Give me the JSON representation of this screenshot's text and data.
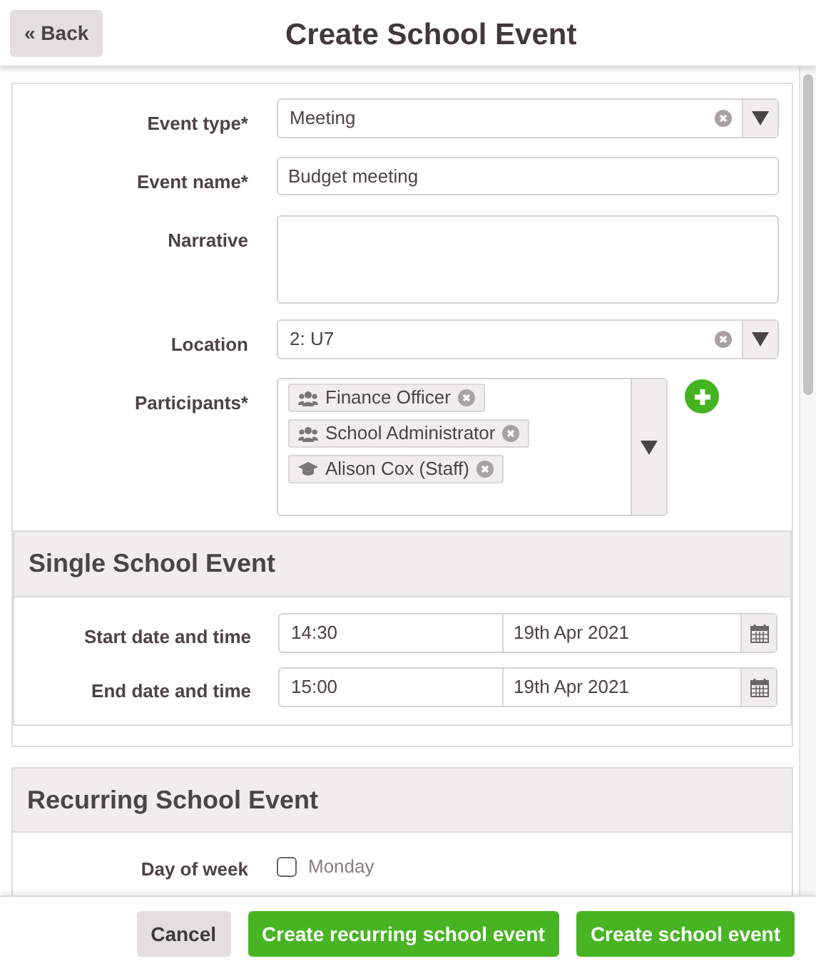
{
  "header": {
    "back_button": "« Back",
    "title": "Create School Event"
  },
  "fields": [
    {
      "kind": "select",
      "label": "Event type*",
      "value": "Meeting"
    },
    {
      "kind": "text",
      "label": "Event name*",
      "value": "Budget meeting"
    },
    {
      "kind": "textarea",
      "label": "Narrative"
    },
    {
      "kind": "select",
      "label": "Location",
      "value": "2: U7"
    },
    {
      "kind": "tags",
      "label": "Participants*",
      "tags": [
        {
          "text": "Finance Officer",
          "kind": "group"
        },
        {
          "text": "School Administrator",
          "kind": "group"
        },
        {
          "text": "Alison Cox (Staff)",
          "kind": "staff"
        }
      ]
    }
  ],
  "single_event": {
    "title": "Single School Event",
    "rows": [
      {
        "label": "Start date and time",
        "time": "14:30",
        "date": "19th Apr 2021"
      },
      {
        "label": "End date and time",
        "time": "15:00",
        "date": "19th Apr 2021"
      }
    ]
  },
  "recurring_event": {
    "title": "Recurring School Event",
    "day_of_week": {
      "label": "Day of week",
      "days": [
        {
          "label": "Monday",
          "checked": false
        }
      ]
    }
  },
  "footer": {
    "buttons": [
      {
        "label": "Cancel",
        "kind": "secondary"
      },
      {
        "label": "Create recurring school event",
        "kind": "primary"
      },
      {
        "label": "Create school event",
        "kind": "primary"
      }
    ]
  }
}
